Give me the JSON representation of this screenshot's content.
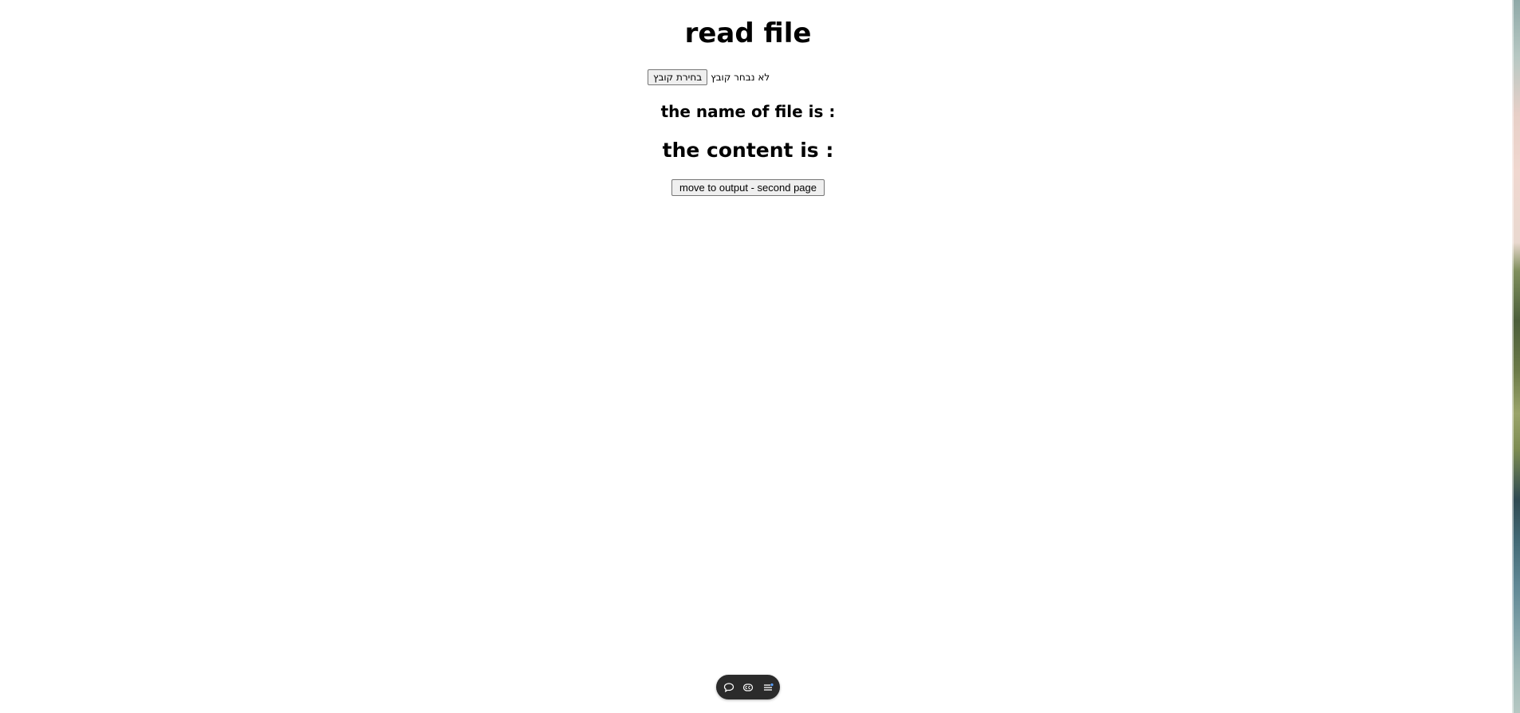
{
  "page": {
    "title": "read file",
    "file_input": {
      "button_label": "בחירת קובץ",
      "status_text": "לא נבחר קובץ"
    },
    "file_name_label": "the name of file is :",
    "content_label": "the content is :",
    "move_button_label": "move to output - second page"
  },
  "floating_toolbar": {
    "items": [
      {
        "icon": "chat-bubble-icon"
      },
      {
        "icon": "caption-icon"
      },
      {
        "icon": "list-menu-icon"
      }
    ]
  },
  "colors": {
    "background": "#ffffff",
    "button_bg": "#efefef",
    "button_border": "#767676",
    "toolbar_bg": "#2b2b2b",
    "toolbar_accent": "#5aa0ff"
  }
}
